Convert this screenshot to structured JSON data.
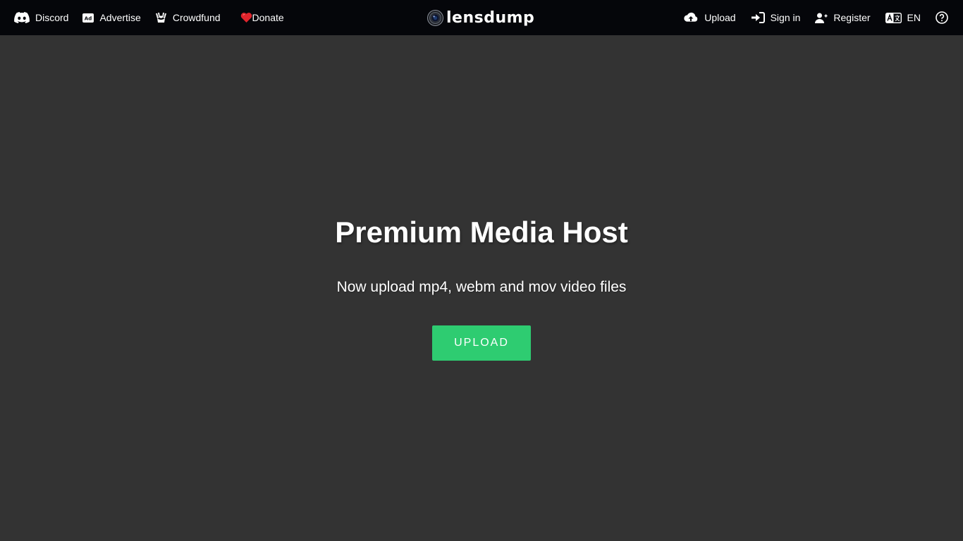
{
  "nav_left": {
    "discord": {
      "label": "Discord",
      "icon": "discord-icon"
    },
    "advertise": {
      "label": "Advertise",
      "icon": "ad-icon"
    },
    "crowdfund": {
      "label": "Crowdfund",
      "icon": "crowdfund-icon"
    },
    "donate": {
      "label": "Donate",
      "icon": "heart-icon"
    }
  },
  "logo": {
    "text": "lensdump",
    "icon": "camera-lens-icon"
  },
  "nav_right": {
    "upload": {
      "label": "Upload",
      "icon": "cloud-upload-icon"
    },
    "sign_in": {
      "label": "Sign in",
      "icon": "sign-in-icon"
    },
    "register": {
      "label": "Register",
      "icon": "user-plus-icon"
    },
    "language": {
      "label": "EN",
      "icon": "language-icon"
    },
    "help": {
      "icon": "help-icon"
    }
  },
  "hero": {
    "title": "Premium Media Host",
    "subtitle": "Now upload mp4, webm and mov video files",
    "button_label": "UPLOAD"
  },
  "colors": {
    "background": "#333333",
    "topbar": "#05060a",
    "accent": "#2ecc71",
    "heart": "#e0242c"
  }
}
